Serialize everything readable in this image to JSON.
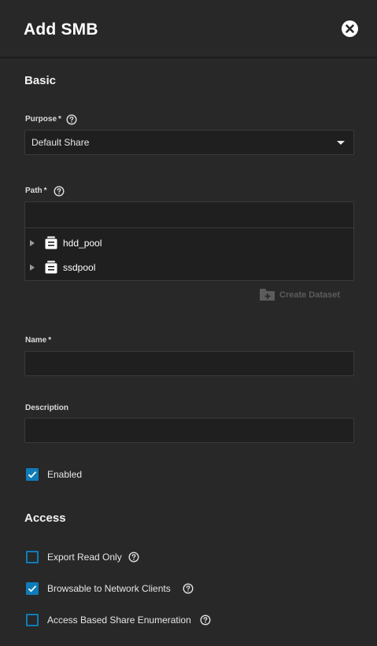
{
  "dialog": {
    "title": "Add SMB"
  },
  "sections": {
    "basic": "Basic",
    "access": "Access"
  },
  "purpose": {
    "label": "Purpose",
    "required_mark": "*",
    "value": "Default Share"
  },
  "path": {
    "label": "Path",
    "required_mark": "*",
    "tree": [
      {
        "label": "hdd_pool",
        "icon": "pool-icon"
      },
      {
        "label": "ssdpool",
        "icon": "pool-icon"
      }
    ],
    "create_dataset_label": "Create Dataset"
  },
  "name": {
    "label": "Name",
    "required_mark": "*",
    "value": ""
  },
  "description": {
    "label": "Description",
    "value": ""
  },
  "enabled": {
    "label": "Enabled",
    "checked": true
  },
  "access": {
    "export_read_only": {
      "label": "Export Read Only",
      "checked": false
    },
    "browsable": {
      "label": "Browsable to Network Clients",
      "checked": true
    },
    "abe": {
      "label": "Access Based Share Enumeration",
      "checked": false
    }
  },
  "colors": {
    "background": "#282828",
    "input_bg": "#1f1f1f",
    "accent": "#0f7bb8"
  }
}
